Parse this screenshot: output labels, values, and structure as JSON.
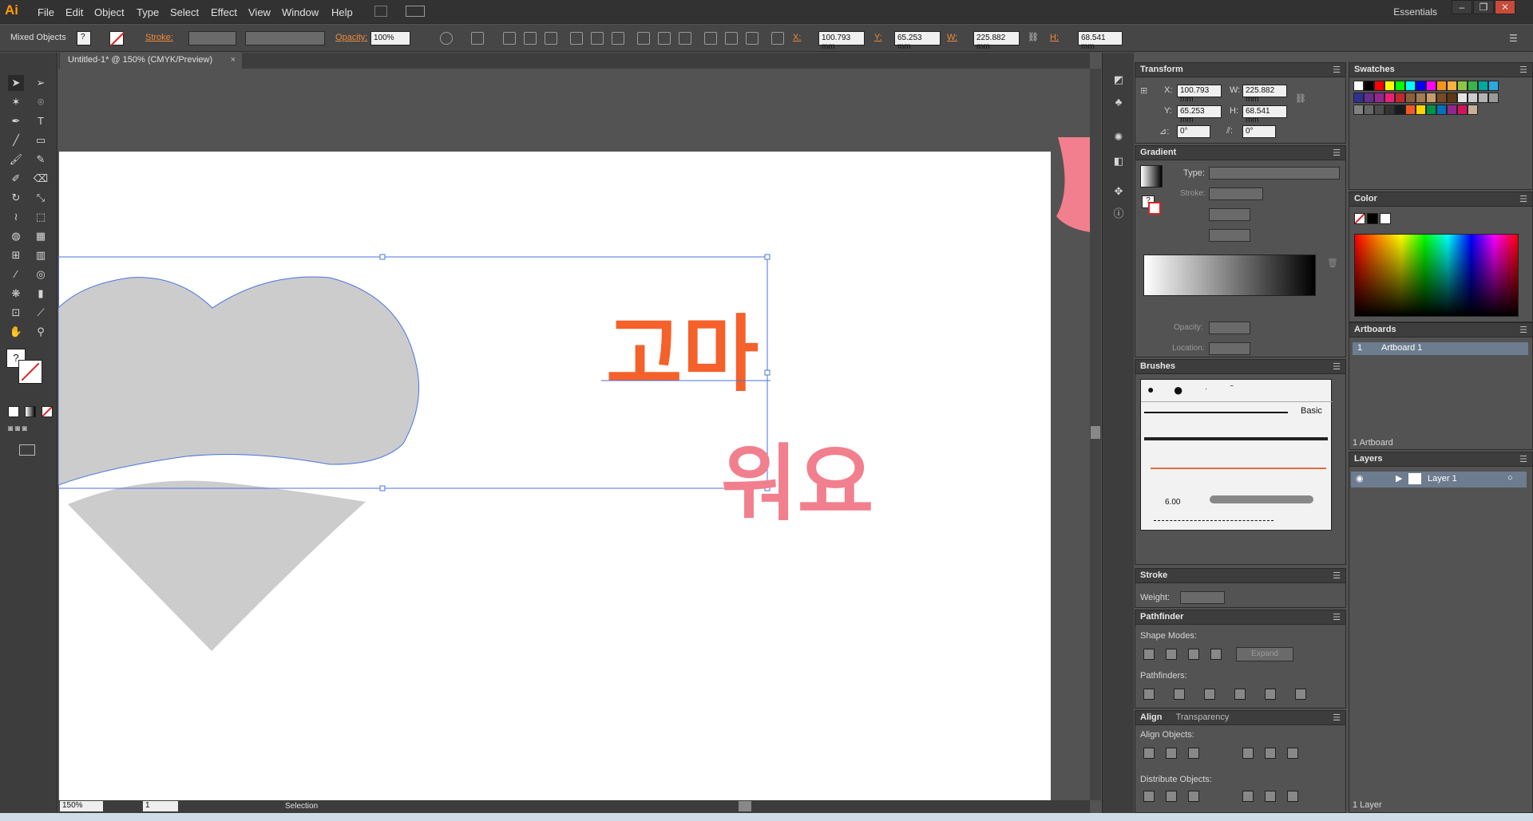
{
  "app": {
    "logo": "Ai",
    "workspace": "Essentials"
  },
  "menu": [
    "File",
    "Edit",
    "Object",
    "Type",
    "Select",
    "Effect",
    "View",
    "Window",
    "Help"
  ],
  "control": {
    "selection": "Mixed Objects",
    "fill_value": "?",
    "stroke_label": "Stroke:",
    "opacity_label": "Opacity:",
    "opacity_value": "100%",
    "x_label": "X:",
    "x_value": "100.793 mm",
    "y_label": "Y:",
    "y_value": "65.253 mm",
    "w_label": "W:",
    "w_value": "225.882 mm",
    "h_label": "H:",
    "h_value": "68.541 mm"
  },
  "document": {
    "tab_title": "Untitled-1* @ 150% (CMYK/Preview)"
  },
  "canvas": {
    "text_top": "고마",
    "text_bottom": "워요",
    "orange": "#f5612a",
    "pink": "#f27f8d",
    "heart_fill": "#cccccc"
  },
  "status": {
    "zoom": "150%",
    "artboard_num": "1",
    "tool": "Selection"
  },
  "transform": {
    "title": "Transform",
    "x_label": "X:",
    "x": "100.793 mm",
    "y_label": "Y:",
    "y": "65.253 mm",
    "w_label": "W:",
    "w": "225.882 mm",
    "h_label": "H:",
    "h": "68.541 mm",
    "angle_label": "⊿:",
    "angle": "0°",
    "shear_label": "⫽:",
    "shear": "0°"
  },
  "gradient": {
    "title": "Gradient",
    "type_label": "Type:",
    "stroke_label": "Stroke:",
    "opacity_label": "Opacity:",
    "location_label": "Location:",
    "question": "?"
  },
  "brushes": {
    "title": "Brushes",
    "basic_label": "Basic",
    "size": "6.00"
  },
  "stroke": {
    "title": "Stroke",
    "weight_label": "Weight:"
  },
  "pathfinder": {
    "title": "Pathfinder",
    "shape_modes": "Shape Modes:",
    "expand": "Expand",
    "pathfinders": "Pathfinders:"
  },
  "align": {
    "title": "Align",
    "tab2": "Transparency",
    "align_objects": "Align Objects:",
    "distribute": "Distribute Objects:"
  },
  "swatches": {
    "title": "Swatches"
  },
  "color": {
    "title": "Color"
  },
  "artboards": {
    "title": "Artboards",
    "row_num": "1",
    "row_name": "Artboard 1",
    "count": "1 Artboard"
  },
  "layers": {
    "title": "Layers",
    "layer_name": "Layer 1",
    "count": "1 Layer"
  }
}
